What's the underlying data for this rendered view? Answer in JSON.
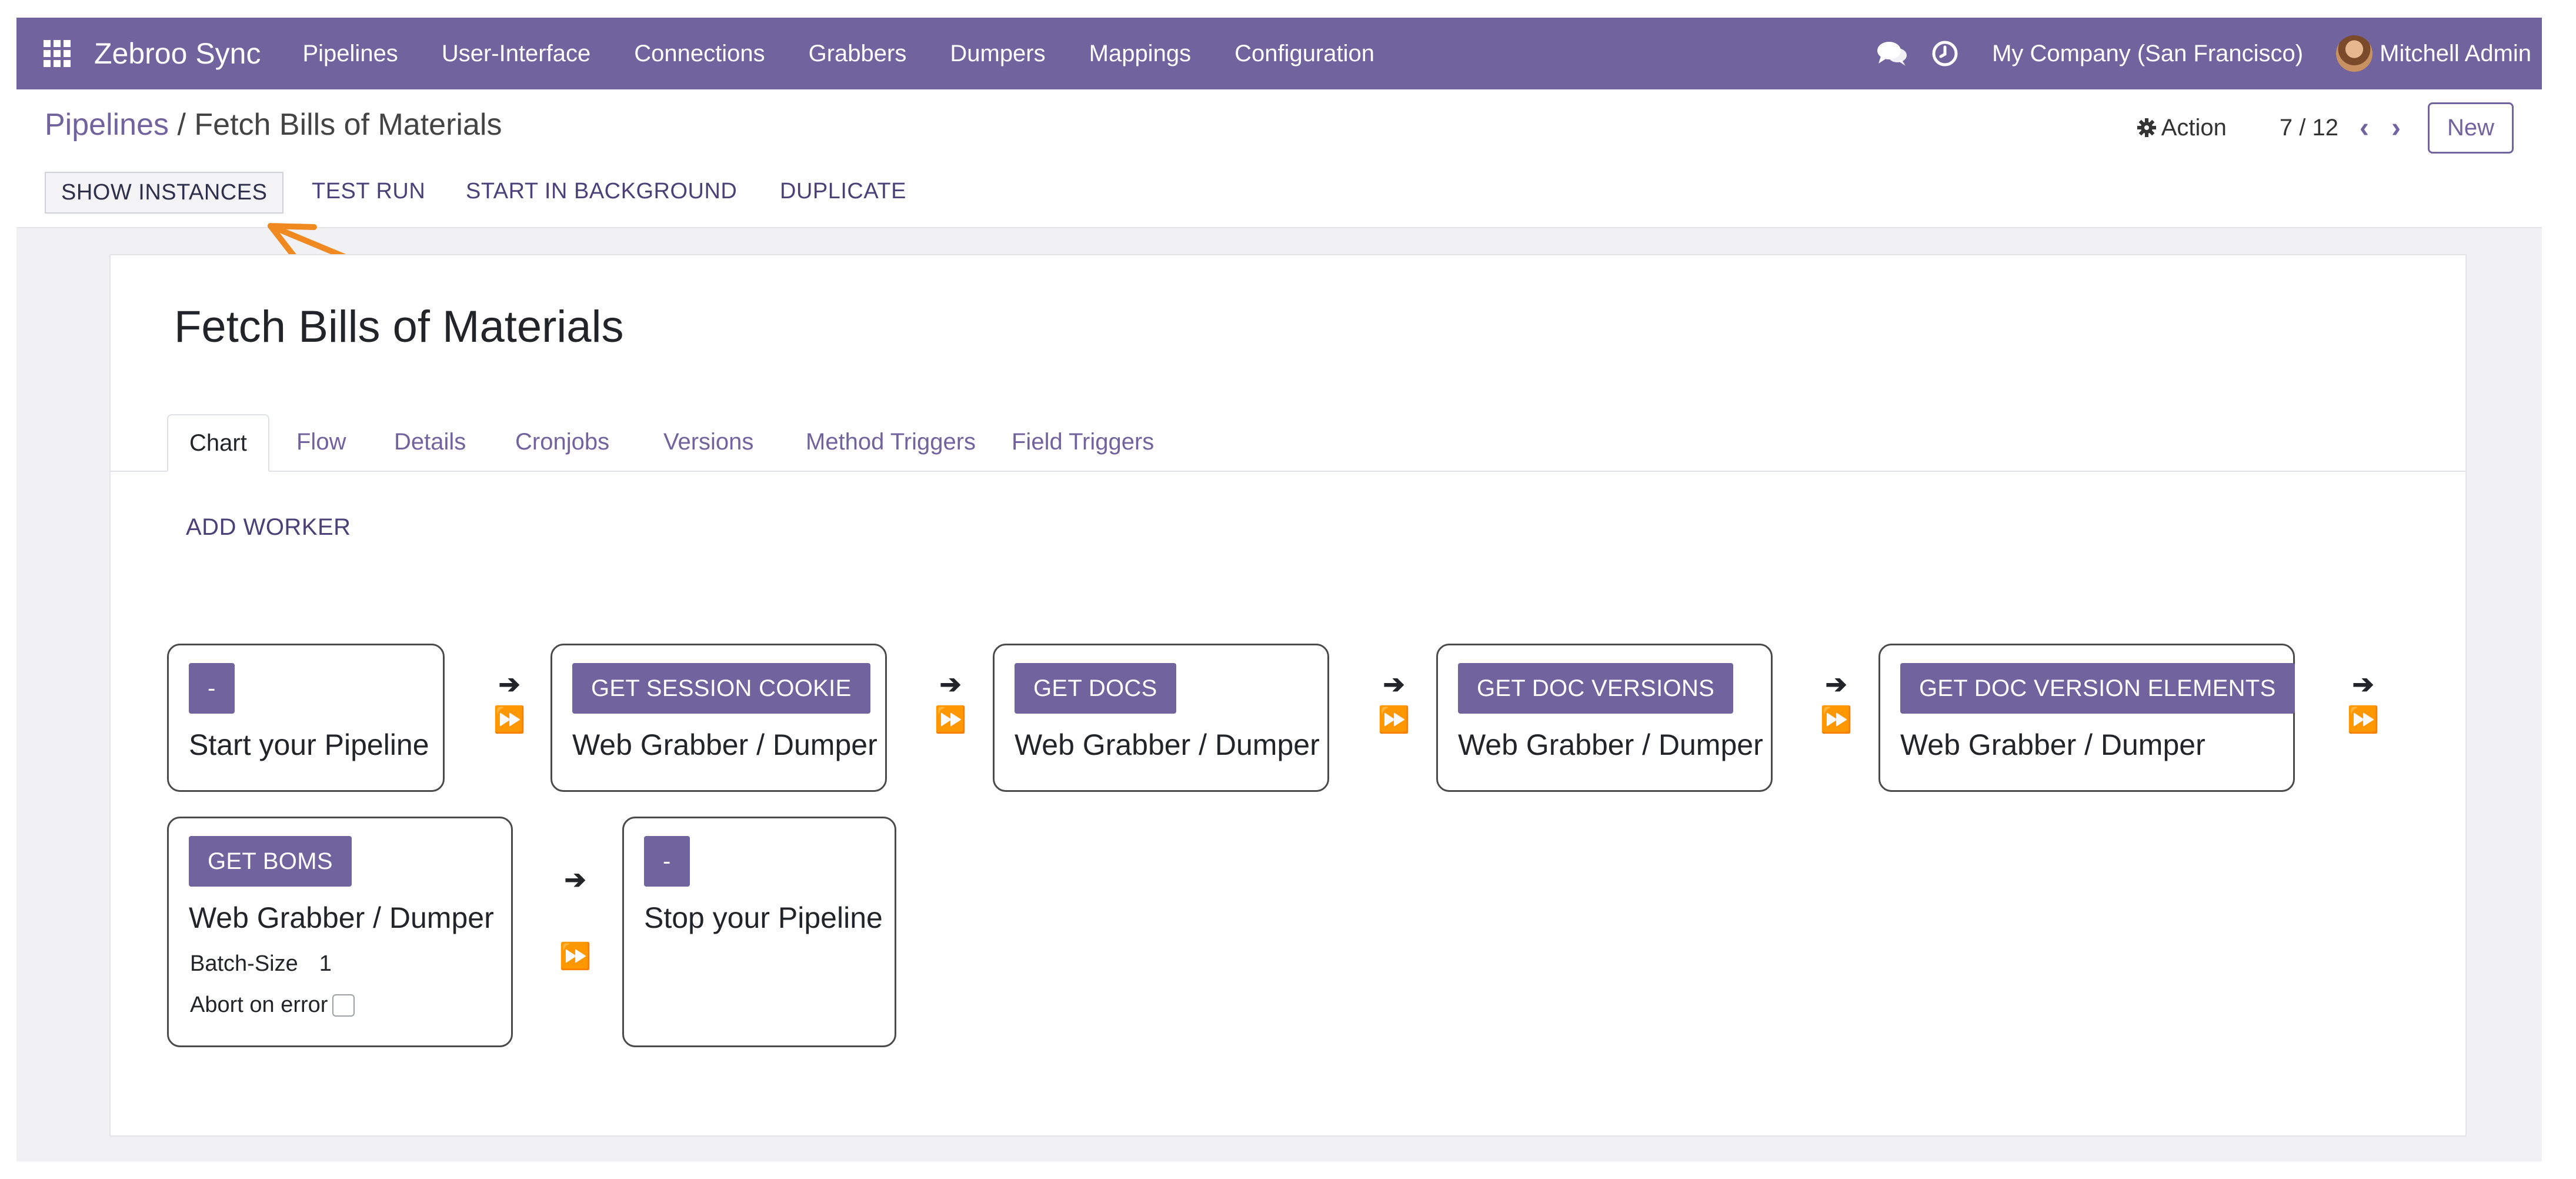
{
  "navbar": {
    "app_name": "Zebroo Sync",
    "menu": [
      "Pipelines",
      "User-Interface",
      "Connections",
      "Grabbers",
      "Dumpers",
      "Mappings",
      "Configuration"
    ],
    "company": "My Company (San Francisco)",
    "user": "Mitchell Admin",
    "bg_color": "#71639e"
  },
  "breadcrumb": {
    "parent": "Pipelines",
    "separator": "/",
    "current": "Fetch Bills of Materials"
  },
  "control": {
    "action_label": "Action",
    "pager": "7 / 12",
    "new_label": "New"
  },
  "header_buttons": [
    "SHOW INSTANCES",
    "TEST RUN",
    "START IN BACKGROUND",
    "DUPLICATE"
  ],
  "record": {
    "title": "Fetch Bills of Materials"
  },
  "tabs": [
    "Chart",
    "Flow",
    "Details",
    "Cronjobs",
    "Versions",
    "Method Triggers",
    "Field Triggers"
  ],
  "active_tab": "Chart",
  "add_worker_label": "ADD WORKER",
  "workers": [
    {
      "badge": "-",
      "name": "Start your Pipeline"
    },
    {
      "badge": "GET SESSION COOKIE",
      "name": "Web Grabber / Dumper"
    },
    {
      "badge": "GET DOCS",
      "name": "Web Grabber / Dumper"
    },
    {
      "badge": "GET DOC VERSIONS",
      "name": "Web Grabber / Dumper"
    },
    {
      "badge": "GET DOC VERSION ELEMENTS",
      "name": "Web Grabber / Dumper"
    },
    {
      "badge": "GET BOMS",
      "name": "Web Grabber / Dumper",
      "batch_size_label": "Batch-Size",
      "batch_size": "1",
      "abort_label": "Abort on error"
    },
    {
      "badge": "-",
      "name": "Stop your Pipeline"
    }
  ],
  "connector": {
    "next_glyph": "➔",
    "skip_glyph": "⏩"
  },
  "accent_color": "#71639e",
  "annotation_color": "#f0891f"
}
